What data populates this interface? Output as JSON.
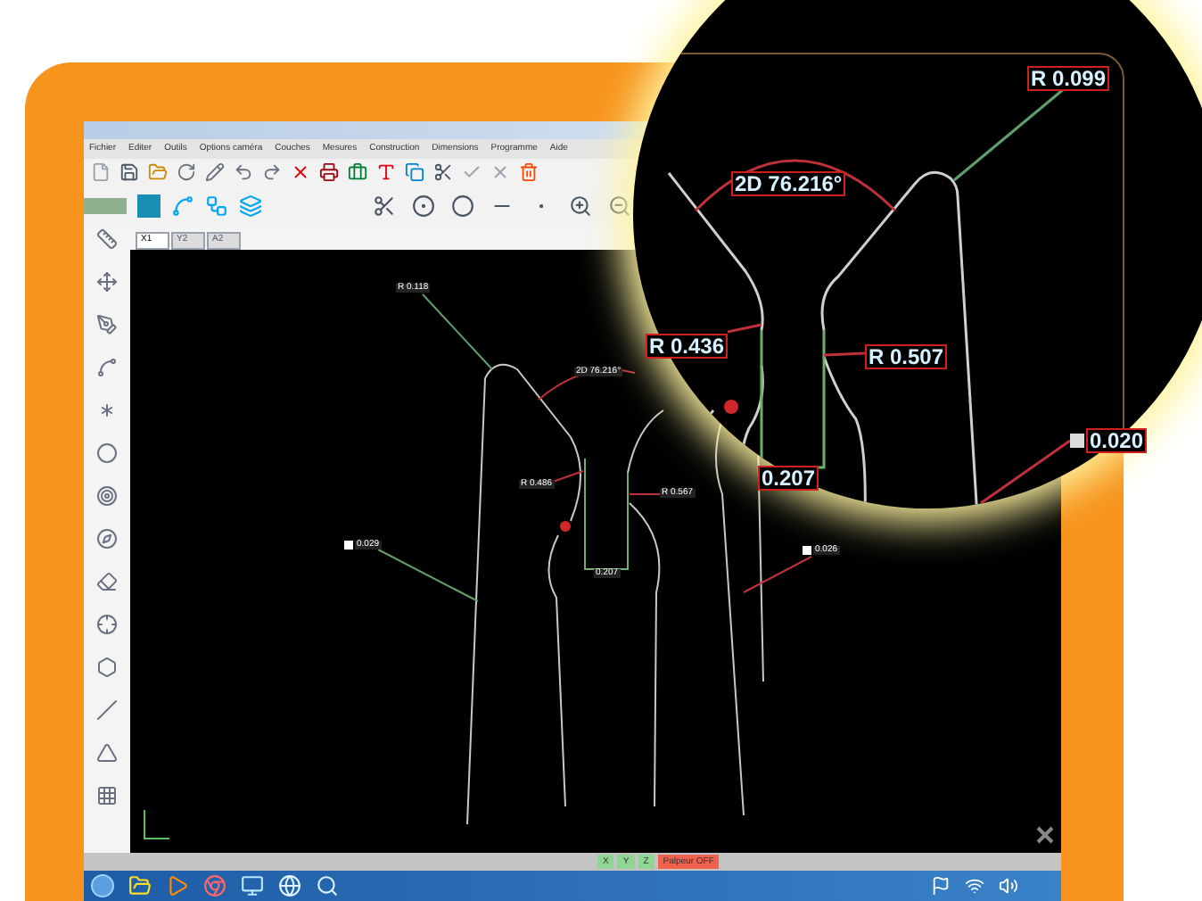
{
  "menu": [
    "Fichier",
    "Editer",
    "Outils",
    "Options caméra",
    "Couches",
    "Mesures",
    "Construction",
    "Dimensions",
    "Programme",
    "Aide"
  ],
  "view_tabs": [
    {
      "label": "X1",
      "selected": true
    },
    {
      "label": "Y2",
      "selected": false
    },
    {
      "label": "A2",
      "selected": false
    }
  ],
  "canvas_labels": [
    {
      "text": "R 0.118",
      "kind": "plain"
    },
    {
      "text": "2D 76.216°",
      "kind": "plain"
    },
    {
      "text": "R 0.486",
      "kind": "plain"
    },
    {
      "text": "R 0.567",
      "kind": "plain"
    },
    {
      "text": "0.207",
      "kind": "plain"
    },
    {
      "text": "0.029",
      "kind": "flagged"
    },
    {
      "text": "0.026",
      "kind": "flagged"
    }
  ],
  "status_bar": [
    {
      "label": "X",
      "color": "#8fd694"
    },
    {
      "label": "Y",
      "color": "#8fd694"
    },
    {
      "label": "Z",
      "color": "#8fd694"
    },
    {
      "label": "Palpeur OFF",
      "color": "#f2604e"
    }
  ],
  "magnifier": {
    "labels": [
      {
        "text": "R 0.099",
        "kind": "plain"
      },
      {
        "text": "2D 76.216°",
        "kind": "plain"
      },
      {
        "text": "R 0.436",
        "kind": "plain"
      },
      {
        "text": "R 0.507",
        "kind": "plain"
      },
      {
        "text": "0.207",
        "kind": "plain"
      },
      {
        "text": "0.020",
        "kind": "flagged"
      }
    ]
  }
}
